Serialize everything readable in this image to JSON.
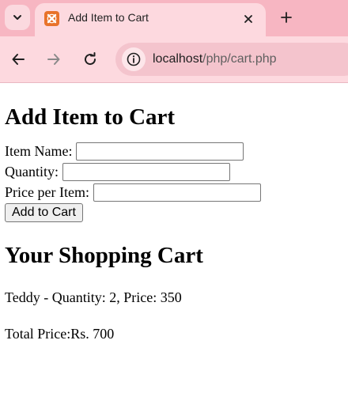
{
  "browser": {
    "tab_title": "Add Item to Cart",
    "url_host": "localhost",
    "url_path": "/php/cart.php",
    "theme_color": "#f7b6c2",
    "favicon_color": "#e8722a",
    "icons": {
      "tab_list": "chevron-down-icon",
      "close": "close-icon",
      "new_tab": "plus-icon",
      "back": "back-arrow-icon",
      "forward": "forward-arrow-icon",
      "reload": "reload-icon",
      "site_info": "info-icon"
    }
  },
  "form": {
    "heading": "Add Item to Cart",
    "item_name_label": "Item Name:",
    "item_name_value": "",
    "quantity_label": "Quantity:",
    "quantity_value": "",
    "price_label": "Price per Item:",
    "price_value": "",
    "submit_label": "Add to Cart"
  },
  "cart": {
    "heading": "Your Shopping Cart",
    "items": [
      {
        "text": "Teddy - Quantity: 2, Price: 350"
      }
    ],
    "total_text": "Total Price:Rs. 700"
  }
}
